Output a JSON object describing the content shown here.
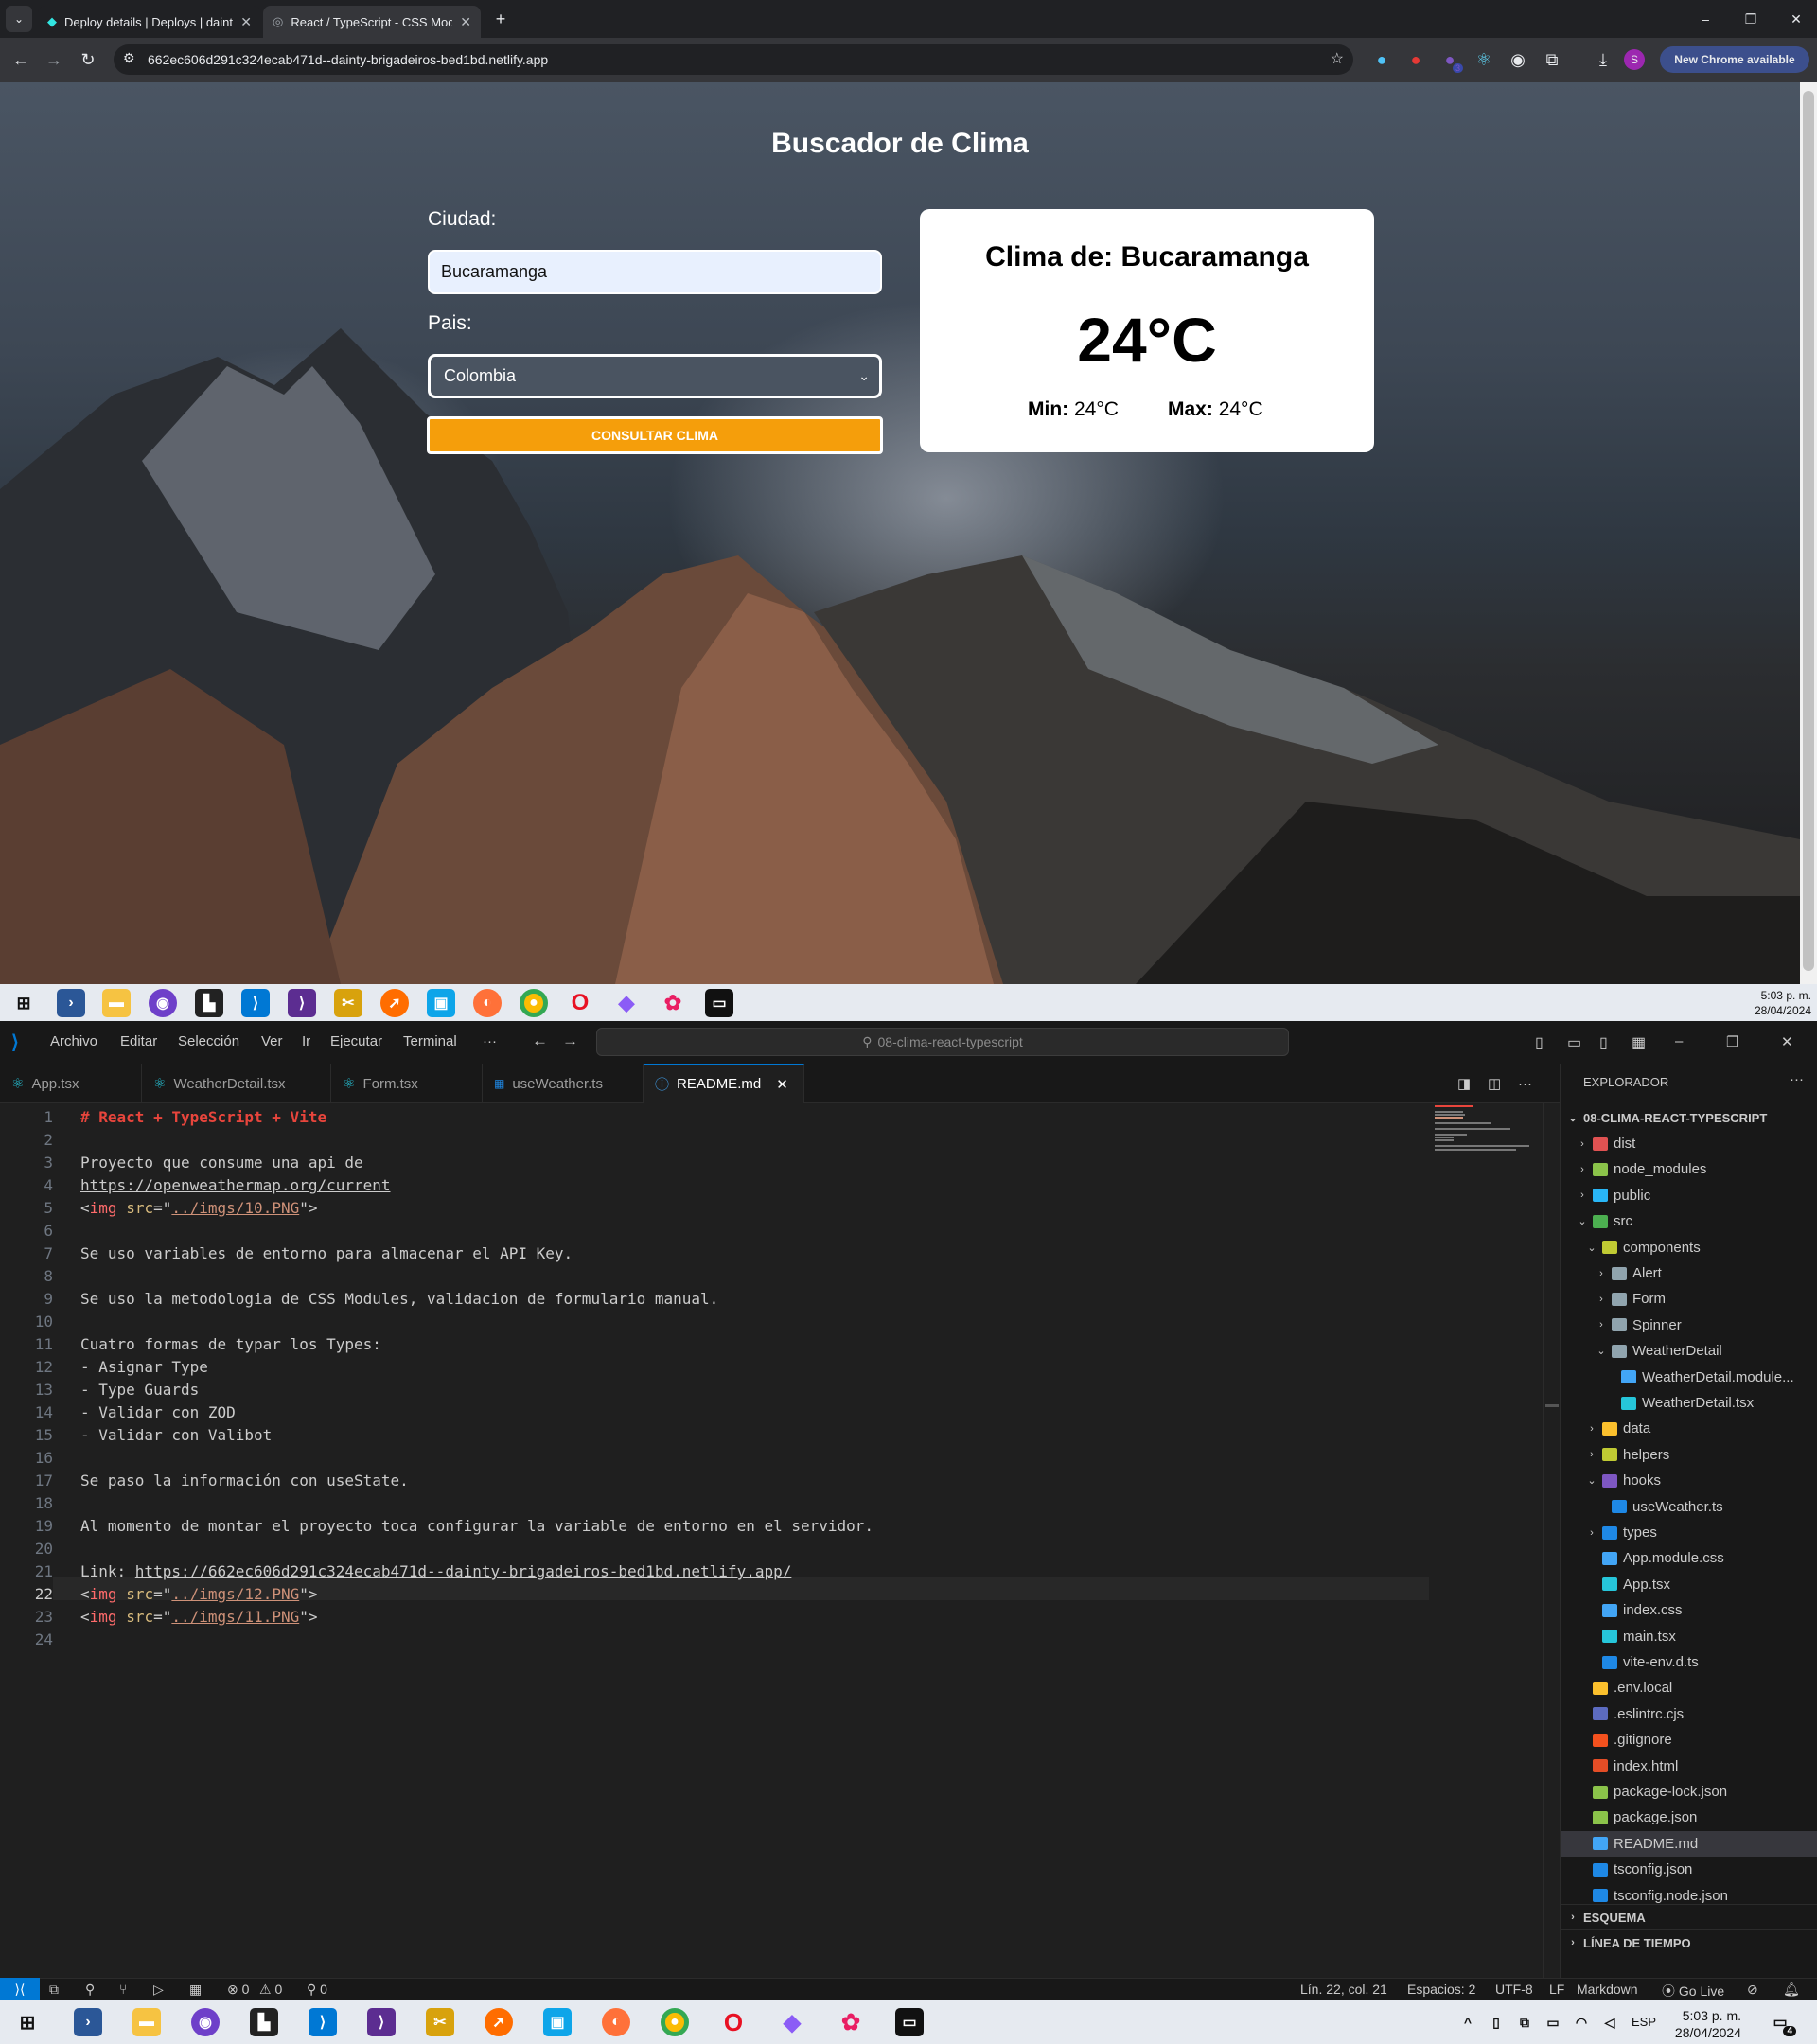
{
  "browser": {
    "tabs": [
      {
        "title": "Deploy details | Deploys | dainty",
        "active": false
      },
      {
        "title": "React / TypeScript - CSS Modules",
        "active": true
      }
    ],
    "new_tab": "+",
    "url": "662ec606d291c324ecab471d--dainty-brigadeiros-bed1bd.netlify.app",
    "new_chrome_label": "New Chrome available",
    "profile_initial": "S",
    "extension_badge": "3",
    "window_controls": {
      "minimize": "–",
      "restore": "❐",
      "close": "✕"
    }
  },
  "weather_app": {
    "title": "Buscador de Clima",
    "city_label": "Ciudad:",
    "city_value": "Bucaramanga",
    "country_label": "Pais:",
    "country_value": "Colombia",
    "submit_label": "CONSULTAR CLIMA",
    "result": {
      "title": "Clima de: Bucaramanga",
      "temp": "24°C",
      "min_label": "Min:",
      "min_value": "24°C",
      "max_label": "Max:",
      "max_value": "24°C"
    }
  },
  "taskbar_top": {
    "time": "5:03 p. m.",
    "date": "28/04/2024"
  },
  "vscode": {
    "menu": [
      "Archivo",
      "Editar",
      "Selección",
      "Ver",
      "Ir",
      "Ejecutar",
      "Terminal",
      "···"
    ],
    "search": "08-clima-react-typescript",
    "tabs": [
      {
        "label": "App.tsx",
        "icon": "react-icon",
        "active": false
      },
      {
        "label": "WeatherDetail.tsx",
        "icon": "react-icon",
        "active": false
      },
      {
        "label": "Form.tsx",
        "icon": "react-icon",
        "active": false
      },
      {
        "label": "useWeather.ts",
        "icon": "ts-icon",
        "active": false
      },
      {
        "label": "README.md",
        "icon": "info-icon",
        "active": true
      }
    ],
    "code": [
      {
        "n": "1",
        "segs": [
          [
            "hd",
            "# React + TypeScript + Vite"
          ]
        ]
      },
      {
        "n": "2",
        "segs": []
      },
      {
        "n": "3",
        "segs": [
          [
            "",
            "Proyecto que consume una api de"
          ]
        ]
      },
      {
        "n": "4",
        "segs": [
          [
            "link",
            "https://openweathermap.org/current"
          ]
        ]
      },
      {
        "n": "5",
        "segs": [
          [
            "",
            "<"
          ],
          [
            "tagc",
            "img"
          ],
          [
            "",
            " "
          ],
          [
            "attrc",
            "src"
          ],
          [
            "",
            "=\""
          ],
          [
            "strc",
            "../imgs/10.PNG"
          ],
          [
            "",
            "\">"
          ]
        ]
      },
      {
        "n": "6",
        "segs": []
      },
      {
        "n": "7",
        "segs": [
          [
            "",
            "Se uso variables de entorno para almacenar el API Key."
          ]
        ]
      },
      {
        "n": "8",
        "segs": []
      },
      {
        "n": "9",
        "segs": [
          [
            "",
            "Se uso la metodologia de CSS Modules, validacion de formulario manual."
          ]
        ]
      },
      {
        "n": "10",
        "segs": []
      },
      {
        "n": "11",
        "segs": [
          [
            "",
            "Cuatro formas de typar los Types:"
          ]
        ]
      },
      {
        "n": "12",
        "segs": [
          [
            "",
            "- Asignar Type"
          ]
        ]
      },
      {
        "n": "13",
        "segs": [
          [
            "",
            "- Type Guards"
          ]
        ]
      },
      {
        "n": "14",
        "segs": [
          [
            "",
            "- Validar con ZOD"
          ]
        ]
      },
      {
        "n": "15",
        "segs": [
          [
            "",
            "- Validar con Valibot"
          ]
        ]
      },
      {
        "n": "16",
        "segs": []
      },
      {
        "n": "17",
        "segs": [
          [
            "",
            "Se paso la información con useState."
          ]
        ]
      },
      {
        "n": "18",
        "segs": []
      },
      {
        "n": "19",
        "segs": [
          [
            "",
            "Al momento de montar el proyecto toca configurar la variable de entorno en el servidor."
          ]
        ]
      },
      {
        "n": "20",
        "segs": []
      },
      {
        "n": "21",
        "segs": [
          [
            "",
            "Link: "
          ],
          [
            "link",
            "https://662ec606d291c324ecab471d--dainty-brigadeiros-bed1bd.netlify.app/"
          ]
        ]
      },
      {
        "n": "22",
        "segs": [
          [
            "",
            "<"
          ],
          [
            "tagc",
            "img"
          ],
          [
            "",
            " "
          ],
          [
            "attrc",
            "src"
          ],
          [
            "",
            "=\""
          ],
          [
            "strc",
            "../imgs/12.PNG"
          ],
          [
            "",
            "\">"
          ]
        ]
      },
      {
        "n": "23",
        "segs": [
          [
            "",
            "<"
          ],
          [
            "tagc",
            "img"
          ],
          [
            "",
            " "
          ],
          [
            "attrc",
            "src"
          ],
          [
            "",
            "=\""
          ],
          [
            "strc",
            "../imgs/11.PNG"
          ],
          [
            "",
            "\">"
          ]
        ]
      },
      {
        "n": "24",
        "segs": []
      }
    ],
    "explorer": {
      "title": "EXPLORADOR",
      "more": "···",
      "root": "08-CLIMA-REACT-TYPESCRIPT",
      "tree": [
        {
          "label": "dist",
          "depth": 1,
          "chev": "›",
          "icon": "folder-dist",
          "color": "#e05252"
        },
        {
          "label": "node_modules",
          "depth": 1,
          "chev": "›",
          "icon": "folder-node",
          "color": "#8bc34a"
        },
        {
          "label": "public",
          "depth": 1,
          "chev": "›",
          "icon": "folder-public",
          "color": "#29b6f6"
        },
        {
          "label": "src",
          "depth": 1,
          "chev": "⌄",
          "icon": "folder-src",
          "color": "#4caf50"
        },
        {
          "label": "components",
          "depth": 2,
          "chev": "⌄",
          "icon": "folder-components",
          "color": "#c0ca33"
        },
        {
          "label": "Alert",
          "depth": 3,
          "chev": "›",
          "icon": "folder",
          "color": "#90a4ae"
        },
        {
          "label": "Form",
          "depth": 3,
          "chev": "›",
          "icon": "folder",
          "color": "#90a4ae"
        },
        {
          "label": "Spinner",
          "depth": 3,
          "chev": "›",
          "icon": "folder",
          "color": "#90a4ae"
        },
        {
          "label": "WeatherDetail",
          "depth": 3,
          "chev": "⌄",
          "icon": "folder-open",
          "color": "#90a4ae"
        },
        {
          "label": "WeatherDetail.module...",
          "depth": 4,
          "chev": "",
          "icon": "css-file",
          "color": "#42a5f5"
        },
        {
          "label": "WeatherDetail.tsx",
          "depth": 4,
          "chev": "",
          "icon": "react-file",
          "color": "#26c6da"
        },
        {
          "label": "data",
          "depth": 2,
          "chev": "›",
          "icon": "folder-data",
          "color": "#fbc02d"
        },
        {
          "label": "helpers",
          "depth": 2,
          "chev": "›",
          "icon": "folder-helpers",
          "color": "#c0ca33"
        },
        {
          "label": "hooks",
          "depth": 2,
          "chev": "⌄",
          "icon": "folder-hooks",
          "color": "#7e57c2"
        },
        {
          "label": "useWeather.ts",
          "depth": 3,
          "chev": "",
          "icon": "ts-file",
          "color": "#1e88e5"
        },
        {
          "label": "types",
          "depth": 2,
          "chev": "›",
          "icon": "folder-types",
          "color": "#1e88e5"
        },
        {
          "label": "App.module.css",
          "depth": 2,
          "chev": "",
          "icon": "css-file",
          "color": "#42a5f5"
        },
        {
          "label": "App.tsx",
          "depth": 2,
          "chev": "",
          "icon": "react-file",
          "color": "#26c6da"
        },
        {
          "label": "index.css",
          "depth": 2,
          "chev": "",
          "icon": "css-file",
          "color": "#42a5f5"
        },
        {
          "label": "main.tsx",
          "depth": 2,
          "chev": "",
          "icon": "react-file",
          "color": "#26c6da"
        },
        {
          "label": "vite-env.d.ts",
          "depth": 2,
          "chev": "",
          "icon": "ts-file",
          "color": "#1e88e5"
        },
        {
          "label": ".env.local",
          "depth": 1,
          "chev": "",
          "icon": "env-file",
          "color": "#fbc02d"
        },
        {
          "label": ".eslintrc.cjs",
          "depth": 1,
          "chev": "",
          "icon": "eslint-file",
          "color": "#5c6bc0"
        },
        {
          "label": ".gitignore",
          "depth": 1,
          "chev": "",
          "icon": "git-file",
          "color": "#f4511e"
        },
        {
          "label": "index.html",
          "depth": 1,
          "chev": "",
          "icon": "html-file",
          "color": "#e44d26"
        },
        {
          "label": "package-lock.json",
          "depth": 1,
          "chev": "",
          "icon": "npm-file",
          "color": "#8bc34a"
        },
        {
          "label": "package.json",
          "depth": 1,
          "chev": "",
          "icon": "npm-file",
          "color": "#8bc34a"
        },
        {
          "label": "README.md",
          "depth": 1,
          "chev": "",
          "icon": "info-file",
          "color": "#42a5f5",
          "selected": true
        },
        {
          "label": "tsconfig.json",
          "depth": 1,
          "chev": "",
          "icon": "tsconfig-file",
          "color": "#1e88e5"
        },
        {
          "label": "tsconfig.node.json",
          "depth": 1,
          "chev": "",
          "icon": "tsconfig-file",
          "color": "#1e88e5"
        }
      ],
      "sections": [
        "ESQUEMA",
        "LÍNEA DE TIEMPO"
      ]
    },
    "status": {
      "errors": "⊗ 0",
      "warnings": "⚠ 0",
      "ports": "⚲ 0",
      "position": "Lín. 22, col. 21",
      "spaces": "Espacios: 2",
      "encoding": "UTF-8",
      "eol": "LF",
      "language": "Markdown",
      "golive": "Go Live"
    }
  },
  "taskbar_bottom": {
    "lang": "ESP",
    "time": "5:03 p. m.",
    "date": "28/04/2024",
    "notif": "4"
  }
}
